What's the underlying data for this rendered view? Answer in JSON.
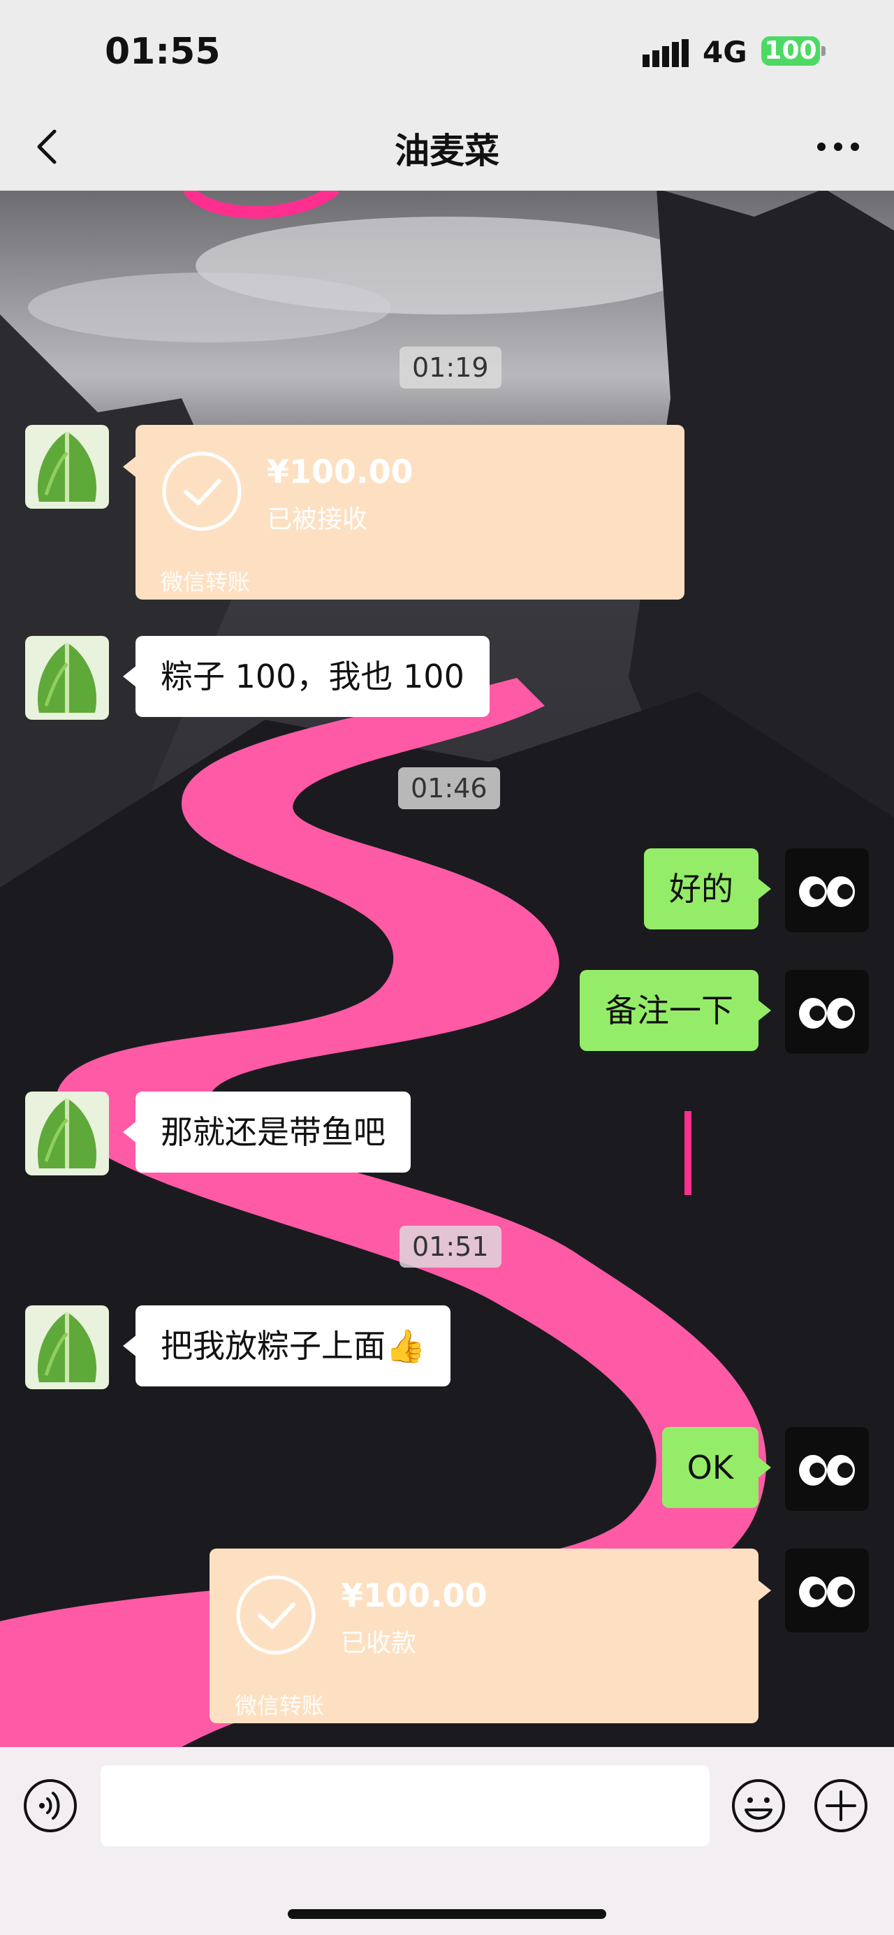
{
  "status": {
    "time": "01:55",
    "network": "4G",
    "battery": "100"
  },
  "header": {
    "title": "油麦菜"
  },
  "messages": {
    "ts1": "01:19",
    "transfer_in": {
      "amount": "¥100.00",
      "status": "已被接收",
      "label": "微信转账"
    },
    "msg1": "粽子 100，我也 100",
    "ts2": "01:46",
    "msg2": "好的",
    "msg3": "备注一下",
    "msg4": "那就还是带鱼吧",
    "ts3": "01:51",
    "msg5": "把我放粽子上面👍",
    "msg6": "OK",
    "transfer_out": {
      "amount": "¥100.00",
      "status": "已收款",
      "label": "微信转账"
    }
  },
  "colors": {
    "my_bubble": "#95ec69",
    "their_bubble": "#ffffff",
    "transfer_card": "#fde0c2",
    "accent_river": "#ff5aa5"
  }
}
